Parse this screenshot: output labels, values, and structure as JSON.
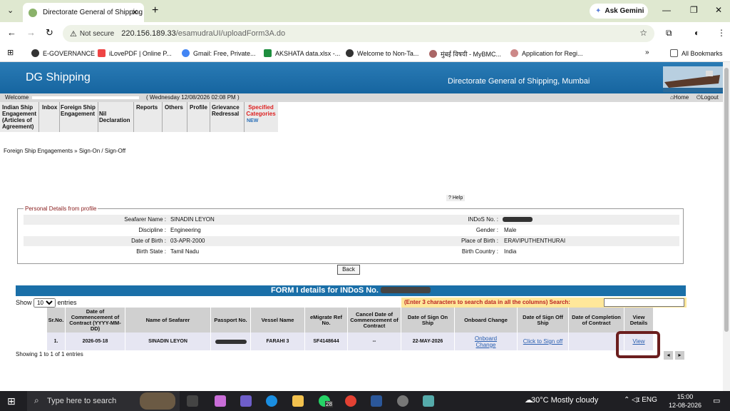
{
  "browser": {
    "tab_title": "Directorate General of Shipping",
    "new_tab": "+",
    "gemini": "Ask Gemini",
    "not_secure": "Not secure",
    "url_host": "220.156.189.33",
    "url_path": "/esamudraUI/uploadForm3A.do"
  },
  "bookmarks": [
    "E-GOVERNANCE",
    "iLovePDF | Online P...",
    "Gmail: Free, Private...",
    "AKSHATA data.xlsx -...",
    "Welcome to Non-Ta...",
    "मुंबई विषयी - MyBMC...",
    "Application for Regi..."
  ],
  "all_bookmarks": "All Bookmarks",
  "site": {
    "logo": "DG Shipping",
    "title": "Directorate General of Shipping, Mumbai",
    "welcome": "Welcome",
    "datetime": "( Wednesday 12/08/2026 02:08 PM )",
    "home": "Home",
    "logout": "Logout"
  },
  "menu": {
    "m1": "Indian Ship Engagement (Articles of Agreement)",
    "m2": "Inbox",
    "m3": "Foreign Ship Engagement",
    "m4": "Nil Declaration",
    "m5": "Reports",
    "m6": "Others",
    "m7": "Profile",
    "m8": "Grievance Redressal",
    "m9": "Specified Categories",
    "new": "NEW"
  },
  "breadcrumb": "Foreign Ship Engagements  »  Sign-On / Sign-Off",
  "help": "Help",
  "profile": {
    "legend": "Personal Details from profile",
    "seafarer_label": "Seafarer Name :",
    "seafarer": "SINADIN LEYON",
    "indos_label": "INDoS No. :",
    "discipline_label": "Discipline :",
    "discipline": "Engineering",
    "gender_label": "Gender :",
    "gender": "Male",
    "dob_label": "Date of Birth :",
    "dob": "03-APR-2000",
    "pob_label": "Place of Birth :",
    "pob": "ERAVIPUTHENTHURAI",
    "bstate_label": "Birth State :",
    "bstate": "Tamil Nadu",
    "bcountry_label": "Birth Country :",
    "bcountry": "India"
  },
  "back": "Back",
  "form_header": "FORM I details for INDoS No.",
  "show": "Show",
  "show_value": "10",
  "entries": "entries",
  "search_hint": "(Enter 3 characters to search data in all the columns) Search:",
  "table": {
    "headers": [
      "Sr.No.",
      "Date of Commencement of Contract (YYYY-MM-DD)",
      "Name of Seafarer",
      "Passport No.",
      "Vessel Name",
      "eMigrate Ref No.",
      "Cancel Date of Commencement of Contract",
      "Date of Sign On Ship",
      "Onboard Change",
      "Date of Sign Off Ship",
      "Date of Completion of Contract",
      "View Details"
    ],
    "row": {
      "srno": "1.",
      "commence": "2026-05-18",
      "name": "SINADIN LEYON",
      "vessel": "FARAHI 3",
      "emigrate": "SF4148644",
      "cancel": "--",
      "signon": "22-MAY-2026",
      "onboard": "Onboard Change",
      "signoff": "Click to Sign off",
      "view": "View"
    }
  },
  "showing": "Showing 1 to 1 of 1 entries",
  "taskbar": {
    "search": "Type here to search",
    "badge": "28",
    "weather": "30°C  Mostly cloudy",
    "lang": "ENG",
    "time": "15:00",
    "date": "12-08-2026"
  }
}
